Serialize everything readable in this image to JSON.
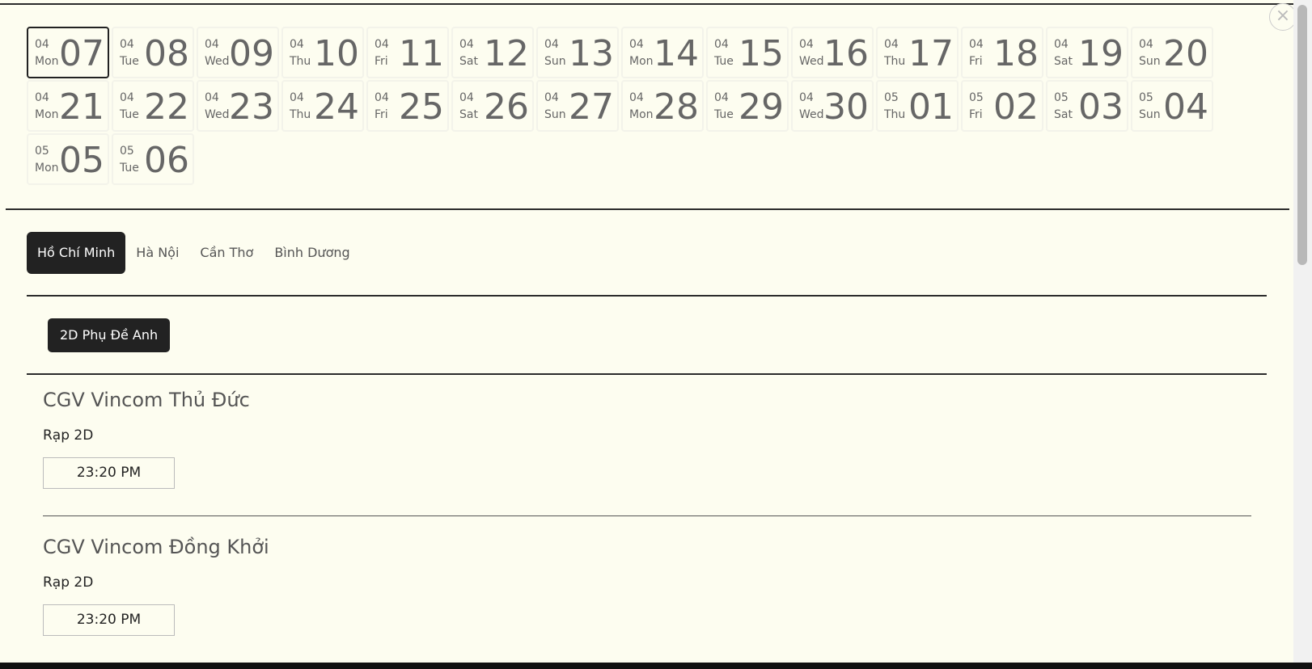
{
  "close_icon": "close-icon",
  "days": [
    {
      "month": "04",
      "weekday": "Mon",
      "day": "07",
      "active": true
    },
    {
      "month": "04",
      "weekday": "Tue",
      "day": "08"
    },
    {
      "month": "04",
      "weekday": "Wed",
      "day": "09"
    },
    {
      "month": "04",
      "weekday": "Thu",
      "day": "10"
    },
    {
      "month": "04",
      "weekday": "Fri",
      "day": "11"
    },
    {
      "month": "04",
      "weekday": "Sat",
      "day": "12"
    },
    {
      "month": "04",
      "weekday": "Sun",
      "day": "13"
    },
    {
      "month": "04",
      "weekday": "Mon",
      "day": "14"
    },
    {
      "month": "04",
      "weekday": "Tue",
      "day": "15"
    },
    {
      "month": "04",
      "weekday": "Wed",
      "day": "16"
    },
    {
      "month": "04",
      "weekday": "Thu",
      "day": "17"
    },
    {
      "month": "04",
      "weekday": "Fri",
      "day": "18"
    },
    {
      "month": "04",
      "weekday": "Sat",
      "day": "19"
    },
    {
      "month": "04",
      "weekday": "Sun",
      "day": "20"
    },
    {
      "month": "04",
      "weekday": "Mon",
      "day": "21"
    },
    {
      "month": "04",
      "weekday": "Tue",
      "day": "22"
    },
    {
      "month": "04",
      "weekday": "Wed",
      "day": "23"
    },
    {
      "month": "04",
      "weekday": "Thu",
      "day": "24"
    },
    {
      "month": "04",
      "weekday": "Fri",
      "day": "25"
    },
    {
      "month": "04",
      "weekday": "Sat",
      "day": "26"
    },
    {
      "month": "04",
      "weekday": "Sun",
      "day": "27"
    },
    {
      "month": "04",
      "weekday": "Mon",
      "day": "28"
    },
    {
      "month": "04",
      "weekday": "Tue",
      "day": "29"
    },
    {
      "month": "04",
      "weekday": "Wed",
      "day": "30"
    },
    {
      "month": "05",
      "weekday": "Thu",
      "day": "01"
    },
    {
      "month": "05",
      "weekday": "Fri",
      "day": "02"
    },
    {
      "month": "05",
      "weekday": "Sat",
      "day": "03"
    },
    {
      "month": "05",
      "weekday": "Sun",
      "day": "04"
    },
    {
      "month": "05",
      "weekday": "Mon",
      "day": "05"
    },
    {
      "month": "05",
      "weekday": "Tue",
      "day": "06"
    }
  ],
  "cities": [
    {
      "label": "Hồ Chí Minh",
      "active": true
    },
    {
      "label": "Hà Nội"
    },
    {
      "label": "Cần Thơ"
    },
    {
      "label": "Bình Dương"
    }
  ],
  "format_label": "2D Phụ Đề Anh",
  "cinemas": [
    {
      "name": "CGV Vincom Thủ Đức",
      "room": "Rạp 2D",
      "time": "23:20 PM"
    },
    {
      "name": "CGV Vincom Đồng Khởi",
      "room": "Rạp 2D",
      "time": "23:20 PM"
    }
  ],
  "colors": {
    "background": "#fdfdf0",
    "accent": "#222222",
    "muted_text": "#666666"
  }
}
